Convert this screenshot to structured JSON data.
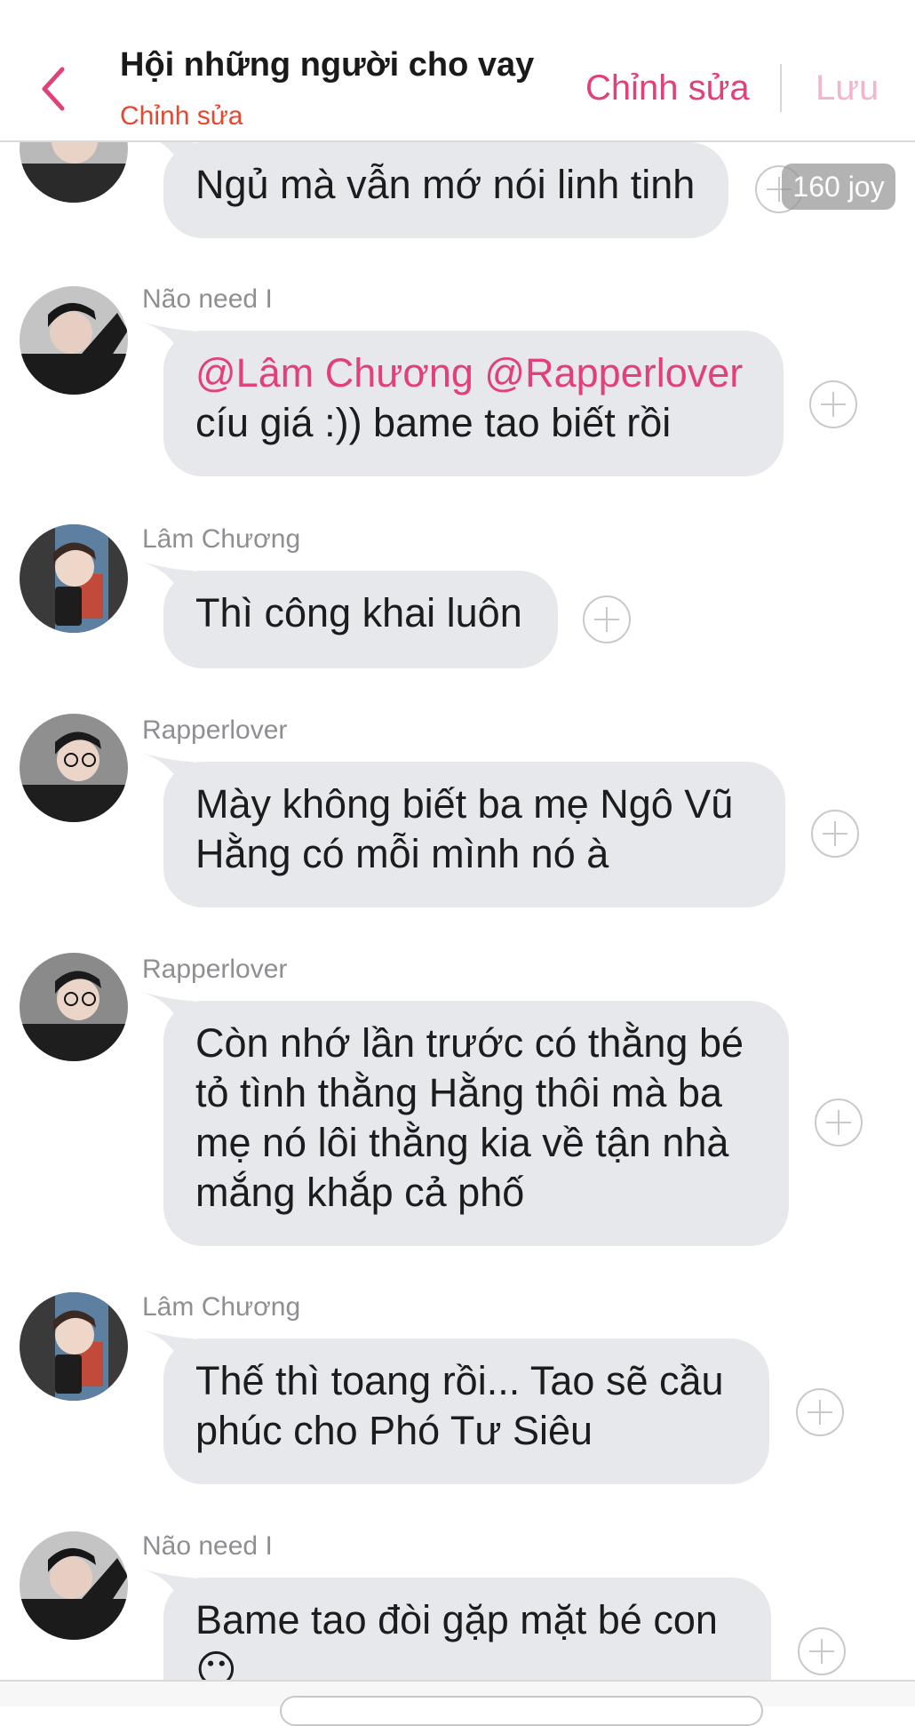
{
  "header": {
    "title": "Hội những người cho vay",
    "subtitle": "Chỉnh sửa",
    "edit_label": "Chỉnh sửa",
    "save_label": "Lưu"
  },
  "colors": {
    "accent": "#e2407b",
    "subtitle": "#e8462f",
    "bubble": "#e6e8eb",
    "save_disabled": "#f4b5cb"
  },
  "joy_badge": "160 joy",
  "messages": [
    {
      "sender": "",
      "text": "Ngủ mà vẫn mớ nói linh tinh"
    },
    {
      "sender": "Não need I",
      "mention": "@Lâm Chương @Rapperlover",
      "text": "cíu giá :)) bame tao biết rồi"
    },
    {
      "sender": "Lâm Chương",
      "text": "Thì công khai luôn"
    },
    {
      "sender": "Rapperlover",
      "line1": "Mày không biết ba mẹ Ngô Vũ",
      "line2": "Hằng có mỗi mình nó à"
    },
    {
      "sender": "Rapperlover",
      "line1": "Còn nhớ lần trước có thằng bé",
      "line2": "tỏ tình thằng Hằng thôi mà ba",
      "line3": "mẹ nó lôi thằng kia về tận nhà",
      "line4": "mắng khắp cả phố"
    },
    {
      "sender": "Lâm Chương",
      "line1": "Thế thì toang rồi... Tao sẽ cầu",
      "line2": "phúc cho Phó Tư Siêu"
    },
    {
      "sender": "Não need I",
      "line1": "Bame tao đòi gặp mặt bé con",
      "emoji": "😶"
    }
  ]
}
